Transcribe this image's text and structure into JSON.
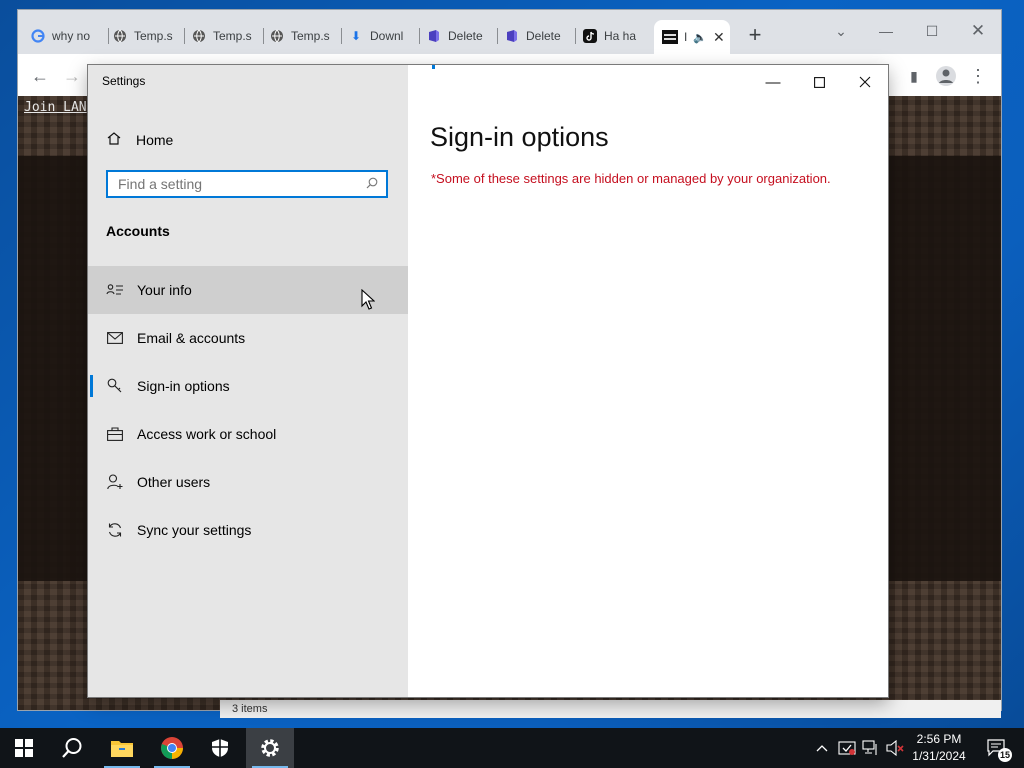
{
  "browser": {
    "tabs": [
      {
        "label": "why no",
        "icon": "google-g-icon"
      },
      {
        "label": "Temp.s",
        "icon": "globe-icon"
      },
      {
        "label": "Temp.s",
        "icon": "globe-icon"
      },
      {
        "label": "Temp.s",
        "icon": "globe-icon"
      },
      {
        "label": "Downl",
        "icon": "download-icon"
      },
      {
        "label": "Delete",
        "icon": "file-icon"
      },
      {
        "label": "Delete",
        "icon": "file-icon"
      },
      {
        "label": "Ha ha",
        "icon": "tiktok-icon"
      },
      {
        "label": "I",
        "icon": "minecraft-icon",
        "active": true
      }
    ],
    "new_tab_label": "+",
    "page": {
      "join_lan_text": "Join LAN",
      "status_text": "3 items"
    }
  },
  "settings": {
    "window_title": "Settings",
    "home_label": "Home",
    "search": {
      "placeholder": "Find a setting",
      "value": ""
    },
    "section_title": "Accounts",
    "nav": [
      {
        "label": "Your info",
        "icon": "person-card-icon",
        "state": "hover"
      },
      {
        "label": "Email & accounts",
        "icon": "mail-icon"
      },
      {
        "label": "Sign-in options",
        "icon": "key-icon",
        "state": "selected"
      },
      {
        "label": "Access work or school",
        "icon": "briefcase-icon"
      },
      {
        "label": "Other users",
        "icon": "add-person-icon"
      },
      {
        "label": "Sync your settings",
        "icon": "sync-icon"
      }
    ],
    "page_title": "Sign-in options",
    "warning": "*Some of these settings are hidden or managed by your organization.",
    "accent_color": "#0078d7",
    "warning_color": "#c50f1f"
  },
  "taskbar": {
    "apps": [
      "start-icon",
      "search-icon",
      "file-explorer-icon",
      "chrome-icon",
      "windows-security-icon",
      "settings-icon"
    ],
    "time": "2:56 PM",
    "date": "1/31/2024",
    "notification_count": "15"
  }
}
